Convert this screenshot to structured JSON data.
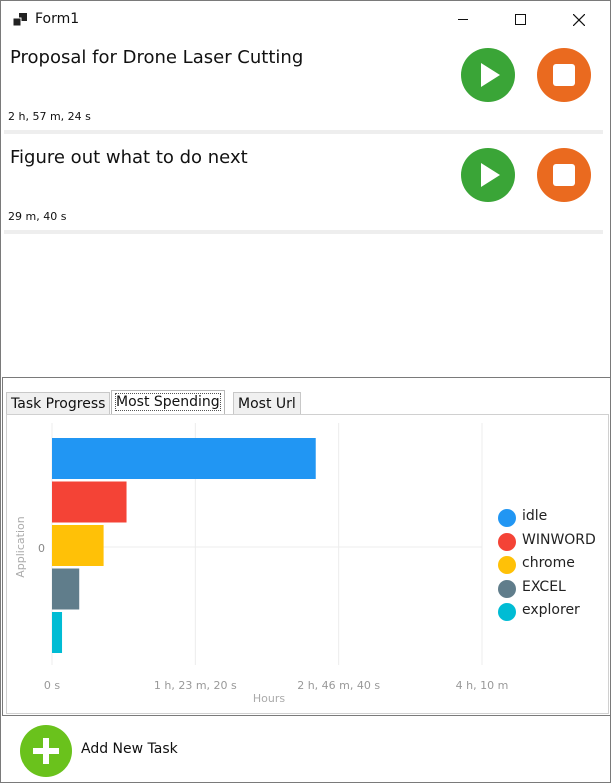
{
  "window": {
    "title": "Form1"
  },
  "tasks": [
    {
      "title": "Proposal for Drone Laser Cutting",
      "elapsed": "2 h, 57 m, 24 s"
    },
    {
      "title": "Figure out what to do next",
      "elapsed": "29 m, 40 s"
    }
  ],
  "tabs": [
    {
      "label": "Task Progress",
      "selected": false
    },
    {
      "label": "Most Spending",
      "selected": true
    },
    {
      "label": "Most Url",
      "selected": false
    }
  ],
  "chart_data": {
    "type": "bar",
    "orientation": "horizontal",
    "xlabel": "Hours",
    "ylabel": "Application",
    "x_tick_labels": [
      "0 s",
      "1 h, 23 m, 20 s",
      "2 h, 46 m, 40 s",
      "4 h, 10 m"
    ],
    "x_ticks_seconds": [
      0,
      5000,
      10000,
      15000
    ],
    "xlim_seconds": [
      0,
      15000
    ],
    "y_tick_labels": [
      "0"
    ],
    "grid": true,
    "legend_position": "right",
    "series": [
      {
        "name": "idle",
        "value_seconds": 9200,
        "color": "#2196f3"
      },
      {
        "name": "WINWORD",
        "value_seconds": 2600,
        "color": "#f44336"
      },
      {
        "name": "chrome",
        "value_seconds": 1800,
        "color": "#ffc107"
      },
      {
        "name": "EXCEL",
        "value_seconds": 950,
        "color": "#607d8b"
      },
      {
        "name": "explorer",
        "value_seconds": 350,
        "color": "#00bcd4"
      }
    ]
  },
  "footer": {
    "add_label": "Add New Task"
  },
  "colors": {
    "play": "#3aa537",
    "stop": "#ea6a1f",
    "add": "#6ac21c"
  }
}
